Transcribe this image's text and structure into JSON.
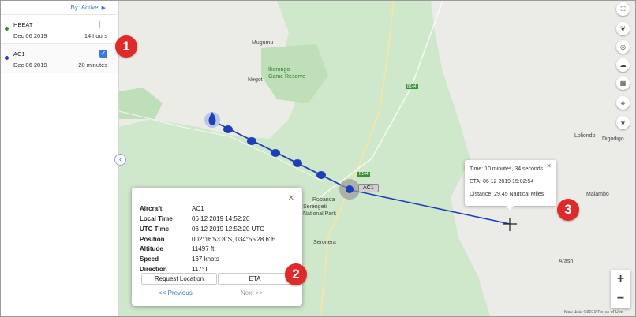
{
  "sidebar": {
    "filter_label": "By: Active",
    "items": [
      {
        "name": "HBEAT",
        "date": "Dec 06 2019",
        "duration": "14 hours",
        "dot_color": "#2e8b2e",
        "checked": false
      },
      {
        "name": "AC1",
        "date": "Dec 06 2019",
        "duration": "20 minutes",
        "dot_color": "#1f3fb8",
        "checked": true
      }
    ]
  },
  "callouts": [
    "1",
    "2",
    "3"
  ],
  "map": {
    "places": [
      "Mugumu",
      "Ikorongo\nGame Reserve",
      "Negot",
      "Robanda",
      "Serengeti\nNational Park",
      "Seronera",
      "Loliondo",
      "Digodigo",
      "Malambo",
      "Arash",
      "B144",
      "B144"
    ],
    "aircraft_label": "AC1",
    "attribution": "Map data ©2019   Terms of Use"
  },
  "info_panel": {
    "rows": [
      {
        "key": "Aircraft",
        "value": "AC1"
      },
      {
        "key": "Local Time",
        "value": "06 12 2019 14:52:20"
      },
      {
        "key": "UTC Time",
        "value": "06 12 2019 12:52:20 UTC"
      },
      {
        "key": "Position",
        "value": "002°16'53.8''S, 034°55'28.6''E"
      },
      {
        "key": "Altitude",
        "value": "11497 ft"
      },
      {
        "key": "Speed",
        "value": "167 knots"
      },
      {
        "key": "Direction",
        "value": "117°T"
      }
    ],
    "request_label": "Request Location",
    "eta_label": "ETA",
    "prev_label": "<<   Previous",
    "next_label": "Next   >>"
  },
  "eta_tooltip": {
    "time": "Time: 10 minutes, 34 seconds",
    "eta": "ETA: 06 12 2019 15:02:54",
    "distance": "Distance: 29.45 Nautical Miles"
  },
  "map_controls": [
    "fullscreen-icon",
    "leaf-icon",
    "target-icon",
    "cloud-icon",
    "map-icon",
    "layers-icon",
    "star-icon"
  ],
  "zoom": {
    "in": "+",
    "out": "−"
  },
  "colors": {
    "accent": "#3b7bd6",
    "track": "#1f3fb8",
    "callout": "#e02a2a"
  }
}
